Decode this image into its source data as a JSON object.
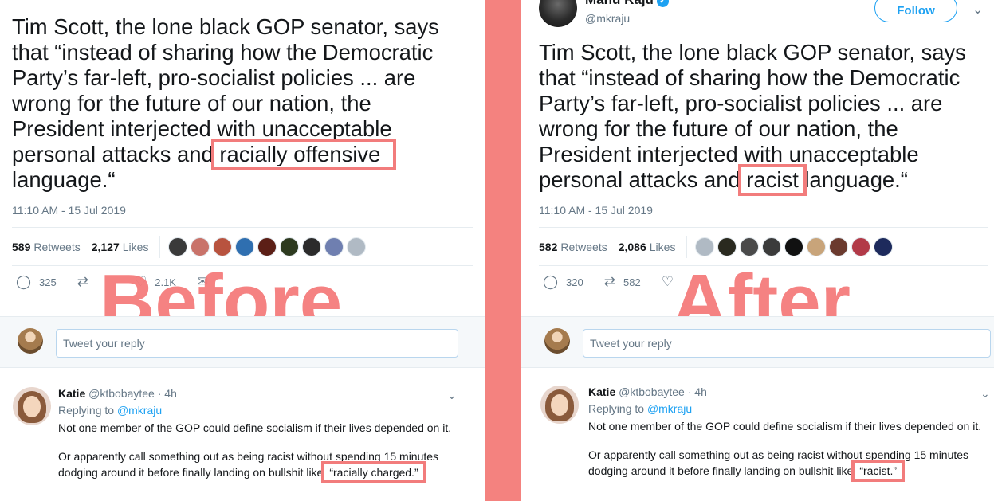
{
  "before": {
    "tweet_lines": [
      "Tim Scott, the lone black GOP senator, says",
      "that “instead of sharing how the Democratic",
      "Party’s far-left, pro-socialist policies ... are",
      "wrong for the future of our nation, the",
      "President interjected with unacceptable"
    ],
    "line6_pre": "personal attacks and ",
    "highlight": "racially offensive",
    "line6_post": "",
    "line7": "language.“",
    "timestamp": "11:10 AM - 15 Jul 2019",
    "retweets_count": "589",
    "retweets_label": "Retweets",
    "likes_count": "2,127",
    "likes_label": "Likes",
    "reply_count": "325",
    "retweet_action_count": "",
    "like_action_count": "2.1K",
    "label": "Before",
    "reply_placeholder": "Tweet your reply",
    "reply": {
      "name": "Katie",
      "handle": "@ktbobaytee",
      "time": "· 4h",
      "replying_prefix": "Replying to",
      "replying_to": "@mkraju",
      "line1": "Not one member of the GOP could define socialism if their lives depended on it.",
      "line2": "Or apparently call something out as being racist without spending 15 minutes",
      "line3_pre": "dodging around it before finally landing on bullshit like",
      "line3_highlight": "“racially charged.”"
    },
    "liker_colors": [
      "#3a3a3a",
      "#c9736a",
      "#b8533f",
      "#2f6fb0",
      "#5c1f16",
      "#2d3a1f",
      "#2b2b2b",
      "#6f7fb0",
      "#b0bac4"
    ]
  },
  "after": {
    "author_name": "Manu Raju",
    "author_handle": "@mkraju",
    "follow_label": "Follow",
    "tweet_lines": [
      "Tim Scott, the lone black GOP senator, says",
      "that “instead of sharing how the Democratic",
      "Party’s far-left, pro-socialist policies ... are",
      "wrong for the future of our nation, the",
      "President interjected with unacceptable"
    ],
    "line6_pre": "personal attacks and ",
    "highlight": "racist",
    "line6_post": " language.“",
    "timestamp": "11:10 AM - 15 Jul 2019",
    "retweets_count": "582",
    "retweets_label": "Retweets",
    "likes_count": "2,086",
    "likes_label": "Likes",
    "reply_count": "320",
    "retweet_action_count": "582",
    "like_action_count": "",
    "label": "After",
    "reply_placeholder": "Tweet your reply",
    "reply": {
      "name": "Katie",
      "handle": "@ktbobaytee",
      "time": "· 4h",
      "replying_prefix": "Replying to",
      "replying_to": "@mkraju",
      "line1": "Not one member of the GOP could define socialism if their lives depended on it.",
      "line2": "Or apparently call something out as being racist without spending 15 minutes",
      "line3_pre": "dodging around it before finally landing on bullshit like",
      "line3_highlight": "“racist.”"
    },
    "liker_colors": [
      "#b0bac4",
      "#2a2a1f",
      "#4a4a4a",
      "#3b3b3b",
      "#111111",
      "#c8a47a",
      "#6b3a2e",
      "#b23a48",
      "#1d2a5c"
    ]
  },
  "colors": {
    "divider": "#f4827f",
    "highlight_box": "#f27c7c",
    "label_text": "#f47979",
    "twitter_blue": "#1da1f2",
    "muted": "#657786"
  }
}
